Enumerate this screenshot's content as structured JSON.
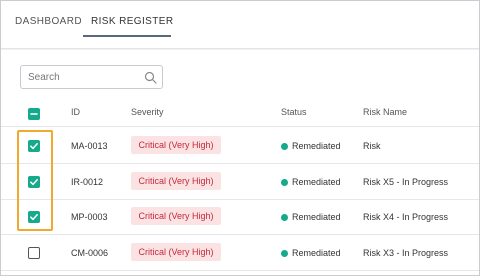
{
  "tabs": [
    {
      "label": "DASHBOARD",
      "active": false
    },
    {
      "label": "RISK REGISTER",
      "active": true
    }
  ],
  "search": {
    "placeholder": "Search",
    "value": ""
  },
  "columns": {
    "id": "ID",
    "severity": "Severity",
    "status": "Status",
    "name": "Risk Name"
  },
  "select_all": {
    "state": "indeterminate"
  },
  "rows": [
    {
      "checked": true,
      "id": "MA-0013",
      "severity": "Critical (Very High)",
      "status": "Remediated",
      "name": "Risk"
    },
    {
      "checked": true,
      "id": "IR-0012",
      "severity": "Critical (Very High)",
      "status": "Remediated",
      "name": "Risk X5 - In Progress"
    },
    {
      "checked": true,
      "id": "MP-0003",
      "severity": "Critical (Very High)",
      "status": "Remediated",
      "name": "Risk X4 - In Progress"
    },
    {
      "checked": false,
      "id": "CM-0006",
      "severity": "Critical (Very High)",
      "status": "Remediated",
      "name": "Risk X3 - In Progress"
    }
  ],
  "colors": {
    "accent": "#17a98b",
    "severity_text": "#c8283a",
    "severity_bg": "#fbe3e4",
    "highlight": "#f0a82e"
  }
}
